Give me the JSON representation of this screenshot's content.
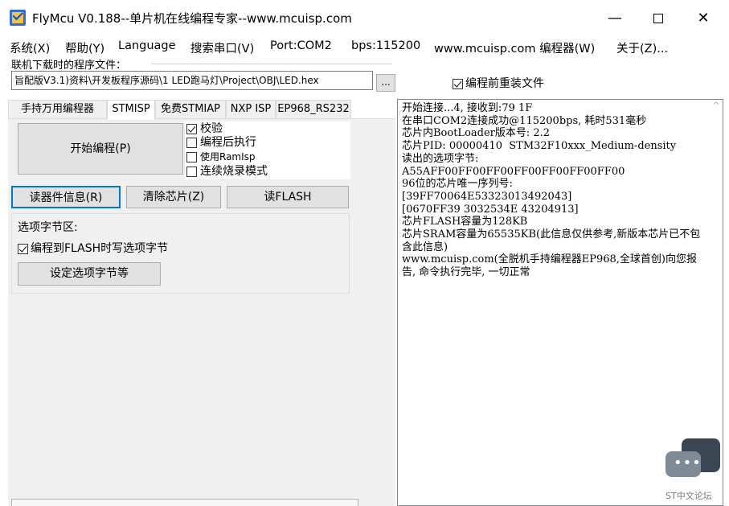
{
  "window": {
    "title": "FlyMcu V0.188--单片机在线编程专家--www.mcuisp.com",
    "minimize": "—",
    "close": "✕"
  },
  "menu": {
    "items": [
      "系统(X)",
      "帮助(Y)",
      "Language",
      "搜索串口(V)",
      "Port:COM2",
      "bps:115200",
      "www.mcuisp.com 编程器(W)",
      "关于(Z)..."
    ]
  },
  "file": {
    "label": "联机下载时的程序文件：",
    "path": "旨配版V3.1)资料\\开发板程序源码\\1  LED跑马灯\\Project\\OBJ\\LED.hex",
    "browse": "...",
    "reload_label": "编程前重装文件",
    "reload_checked": true
  },
  "tabs": [
    "手持万用编程器",
    "STMISP",
    "免费STMIAP",
    "NXP ISP",
    "EP968_RS232"
  ],
  "active_tab": "STMISP",
  "stmisp": {
    "start_button": "开始编程(P)",
    "options": [
      {
        "label": "校验",
        "checked": true
      },
      {
        "label": "编程后执行",
        "checked": false
      },
      {
        "label": "使用RamIsp",
        "checked": false
      },
      {
        "label": "连续烧录模式",
        "checked": false
      }
    ],
    "read_info_button": "读器件信息(R)",
    "erase_button": "清除芯片(Z)",
    "read_flash_button": "读FLASH",
    "option_section_title": "选项字节区:",
    "flash_check_label": "编程到FLASH时写选项字节",
    "flash_check_checked": true,
    "set_option_button": "设定选项字节等"
  },
  "log": {
    "lines": [
      "开始连接...4, 接收到:79 1F",
      "在串口COM2连接成功@115200bps, 耗时531毫秒",
      "芯片内BootLoader版本号: 2.2",
      "芯片PID: 00000410  STM32F10xxx_Medium-density",
      "读出的选项字节:",
      "A55AFF00FF00FF00FF00FF00FF00FF00",
      "96位的芯片唯一序列号:",
      "[39FF70064E53323013492043]",
      "[0670FF39 3032534E 43204913]",
      "芯片FLASH容量为128KB",
      "芯片SRAM容量为65535KB(此信息仅供参考,新版本芯片已不包含此信息)",
      "www.mcuisp.com(全脱机手持编程器EP968,全球首创)向您报告, 命令执行完毕, 一切正常"
    ]
  },
  "watermark": {
    "text": "ST中文论坛"
  }
}
